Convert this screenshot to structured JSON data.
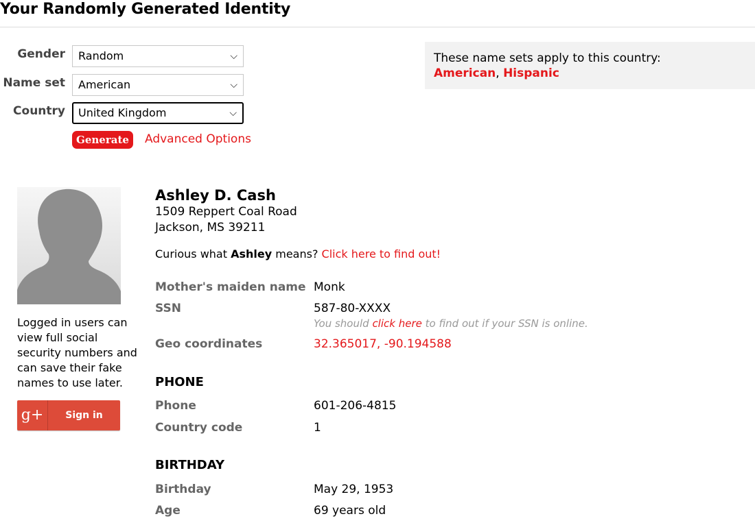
{
  "page": {
    "title": "Your Randomly Generated Identity"
  },
  "form": {
    "gender": {
      "label": "Gender",
      "value": "Random"
    },
    "name_set": {
      "label": "Name set",
      "value": "American"
    },
    "country": {
      "label": "Country",
      "value": "United Kingdom"
    },
    "generate_label": "Generate",
    "advanced_label": "Advanced Options"
  },
  "country_info": {
    "text": "These name sets apply to this country:",
    "sets": [
      "American",
      "Hispanic"
    ],
    "separator": ", "
  },
  "sidebar": {
    "login_note": "Logged in users can view full social security numbers and can save their fake names to use later.",
    "signin_icon": "g+",
    "signin_label": "Sign in"
  },
  "identity": {
    "name": "Ashley D. Cash",
    "address_line1": "1509 Reppert Coal Road",
    "address_line2": "Jackson, MS 39211",
    "curious_prefix": "Curious what ",
    "first_name": "Ashley",
    "curious_suffix": " means? ",
    "curious_link": "Click here to find out!",
    "mothers_maiden_label": "Mother's maiden name",
    "mothers_maiden": "Monk",
    "ssn_label": "SSN",
    "ssn": "587-80-XXXX",
    "ssn_hint_prefix": "You should ",
    "ssn_hint_link": "click here",
    "ssn_hint_suffix": " to find out if your SSN is online.",
    "geo_label": "Geo coordinates",
    "geo": "32.365017, -90.194588"
  },
  "phone": {
    "heading": "PHONE",
    "phone_label": "Phone",
    "phone": "601-206-4815",
    "country_code_label": "Country code",
    "country_code": "1"
  },
  "birthday": {
    "heading": "BIRTHDAY",
    "birthday_label": "Birthday",
    "birthday": "May 29, 1953",
    "age_label": "Age",
    "age": "69 years old"
  },
  "colors": {
    "accent": "#e4181b",
    "google": "#dd4b39",
    "panel": "#f2f2f2"
  }
}
